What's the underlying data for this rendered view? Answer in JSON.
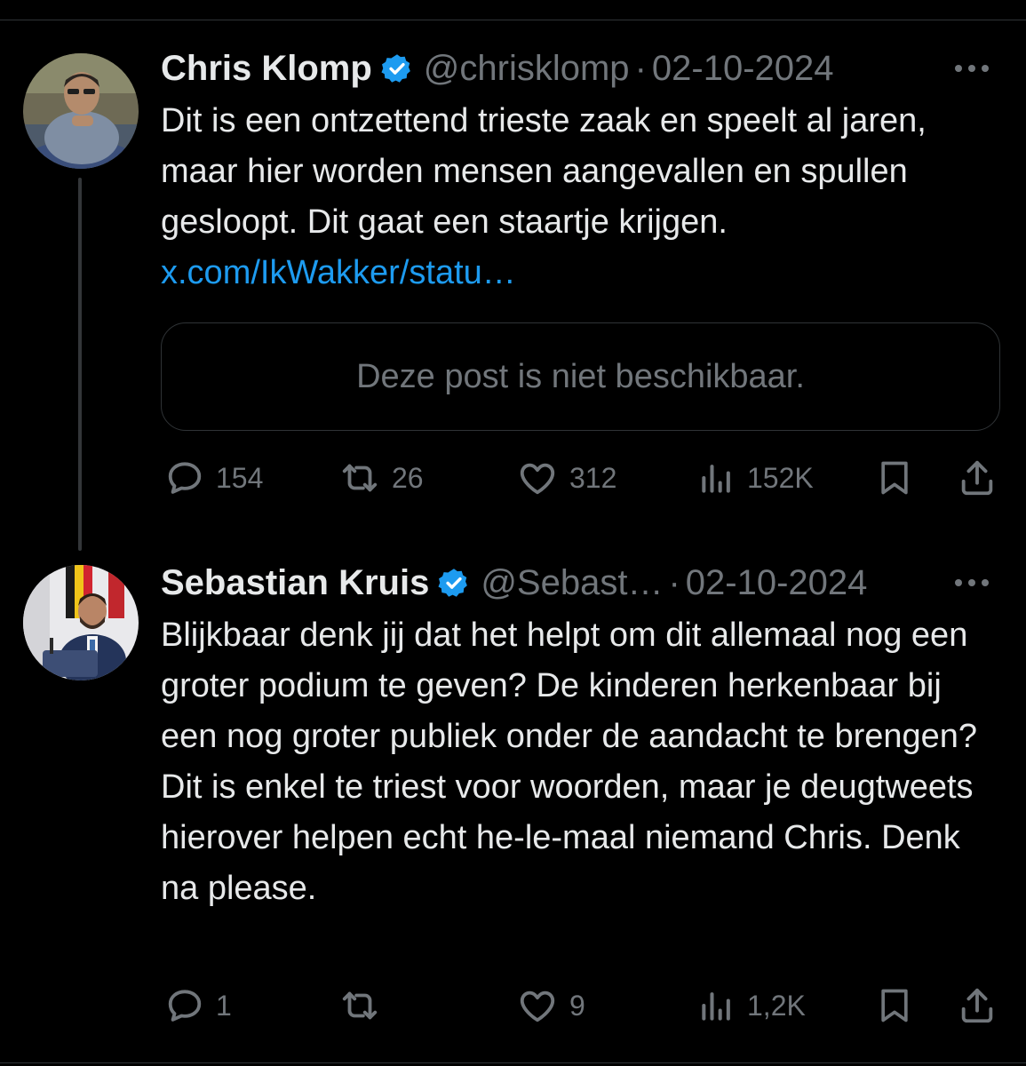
{
  "tweet1": {
    "name": "Chris Klomp",
    "handle": "@chrisklomp",
    "separator": "·",
    "date": "02-10-2024",
    "text": "Dit is een ontzettend trieste zaak en speelt al jaren, maar hier worden mensen aangevallen en spullen gesloopt. Dit gaat een staartje krijgen.",
    "link": "x.com/IkWakker/statu…",
    "quote_unavailable": "Deze post is niet beschikbaar.",
    "replies": "154",
    "reposts": "26",
    "likes": "312",
    "views": "152K"
  },
  "tweet2": {
    "name": "Sebastian Kruis",
    "handle": "@Sebast…",
    "separator": "·",
    "date": "02-10-2024",
    "text": "Blijkbaar denk jij dat het helpt om dit allemaal nog een groter podium te geven? De kinderen herkenbaar bij een nog groter publiek onder de aandacht te brengen? Dit is enkel te triest voor woorden, maar je deugtweets hierover helpen echt he-le-maal niemand Chris. Denk na please.",
    "replies": "1",
    "reposts": "",
    "likes": "9",
    "views": "1,2K"
  },
  "icons": {
    "verified": "verified-badge-icon",
    "more": "more-icon",
    "reply": "reply-icon",
    "repost": "repost-icon",
    "like": "heart-icon",
    "views": "views-icon",
    "bookmark": "bookmark-icon",
    "share": "share-icon"
  },
  "colors": {
    "background": "#000000",
    "text": "#e7e9ea",
    "muted": "#71767b",
    "accent": "#1d9bf0"
  }
}
